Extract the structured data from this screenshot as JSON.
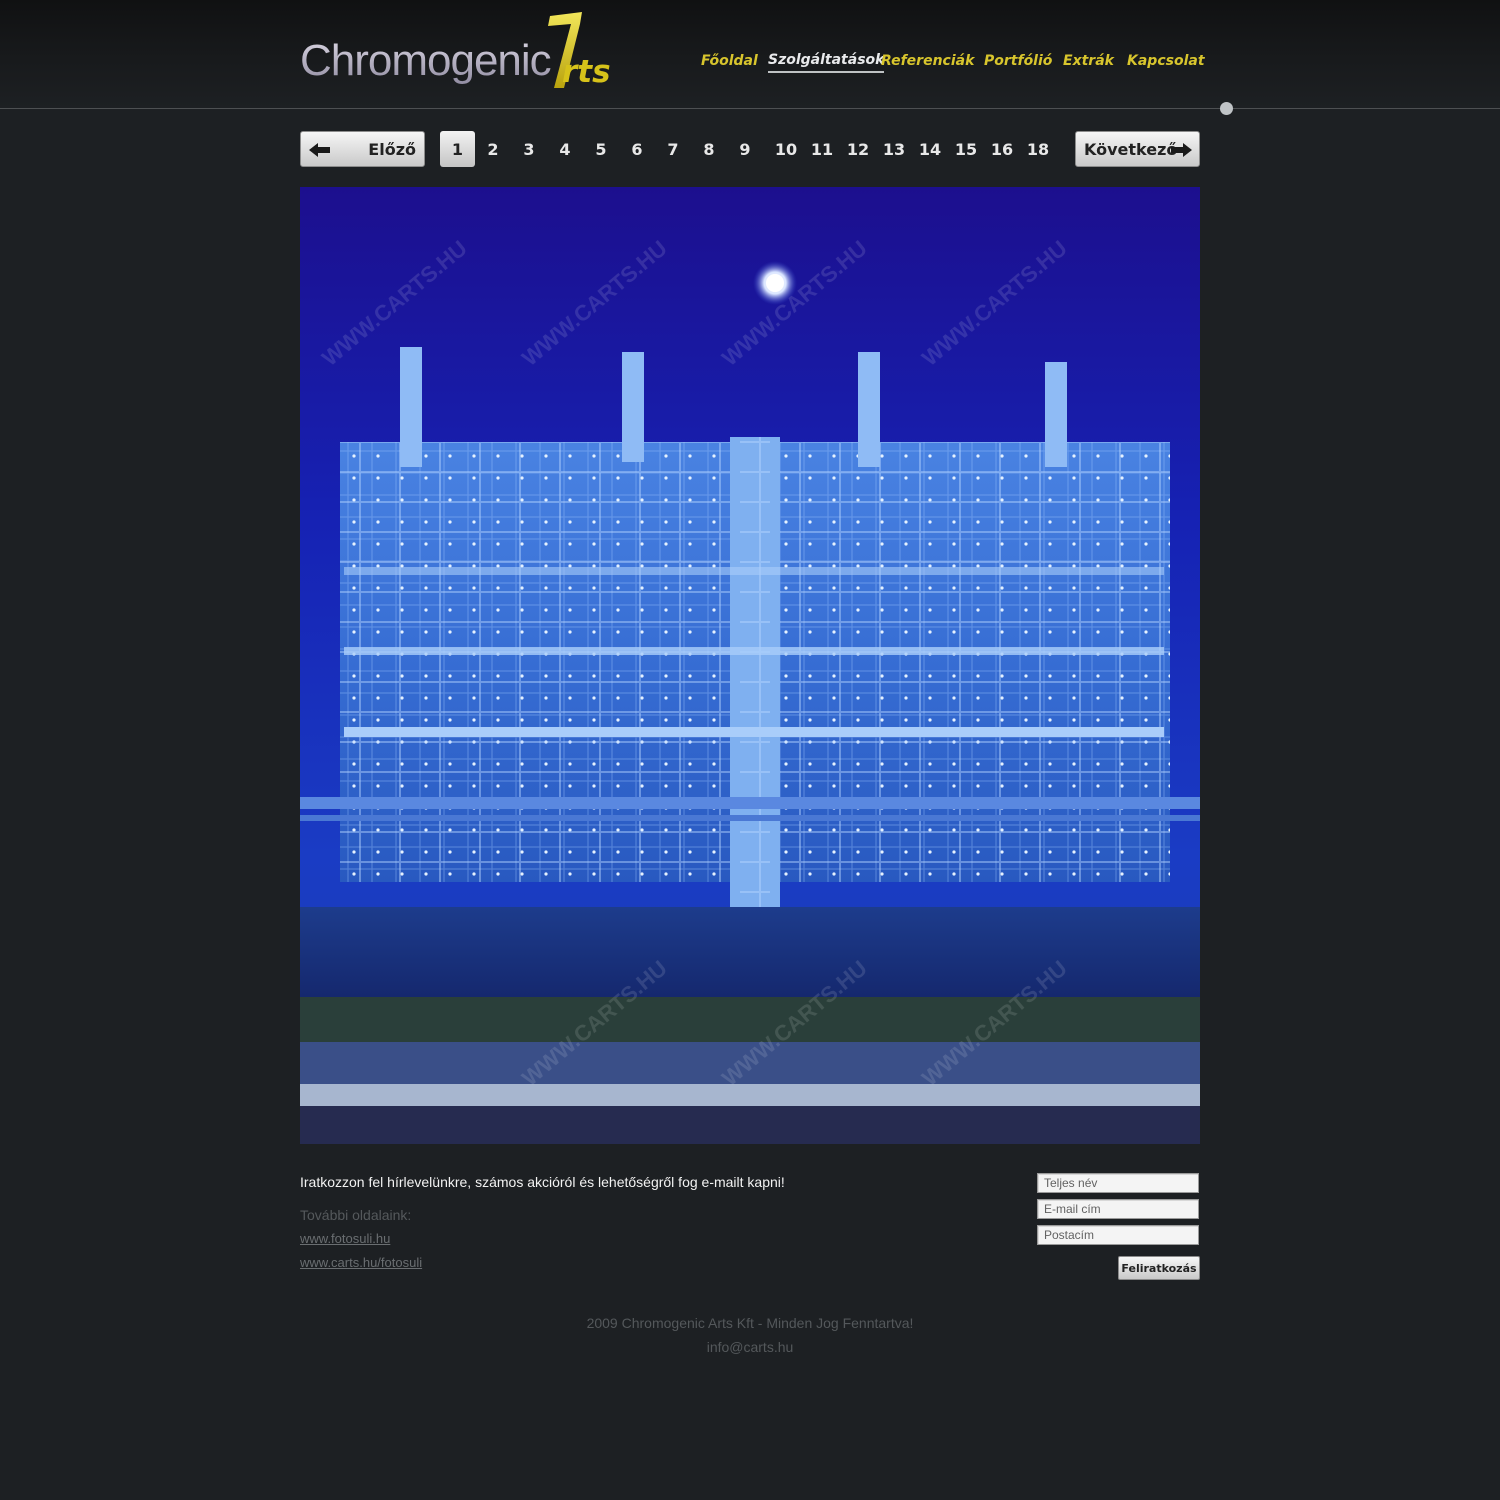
{
  "logo": {
    "word": "Chromogenic",
    "suffix": "rts"
  },
  "nav": [
    {
      "label": "Főoldal",
      "active": false
    },
    {
      "label": "Szolgáltatások",
      "active": true
    },
    {
      "label": "Referenciák",
      "active": false
    },
    {
      "label": "Portfólió",
      "active": false
    },
    {
      "label": "Extrák",
      "active": false
    },
    {
      "label": "Kapcsolat",
      "active": false
    }
  ],
  "pager": {
    "prev_label": "Előző",
    "next_label": "Következő",
    "pages": [
      "1",
      "2",
      "3",
      "4",
      "5",
      "6",
      "7",
      "8",
      "9",
      "10",
      "11",
      "12",
      "13",
      "14",
      "15",
      "16",
      "18"
    ],
    "current": "1"
  },
  "photo": {
    "watermark": "WWW.CARTS.HU"
  },
  "newsletter": {
    "text": "Iratkozzon fel hírlevelünkre, számos akcióról és lehetőségről fog e-mailt kapni!",
    "name_placeholder": "Teljes név",
    "email_placeholder": "E-mail cím",
    "address_placeholder": "Postacím",
    "subscribe_label": "Feliratkozás"
  },
  "more_sites": {
    "label": "További oldalaink:",
    "links": [
      "www.fotosuli.hu",
      "www.carts.hu/fotosuli"
    ]
  },
  "footer": {
    "copyright": "2009 Chromogenic Arts Kft - Minden Jog Fenntartva!",
    "email": "info@carts.hu"
  },
  "colors": {
    "accent": "#d8c52d",
    "background": "#1d2023"
  }
}
